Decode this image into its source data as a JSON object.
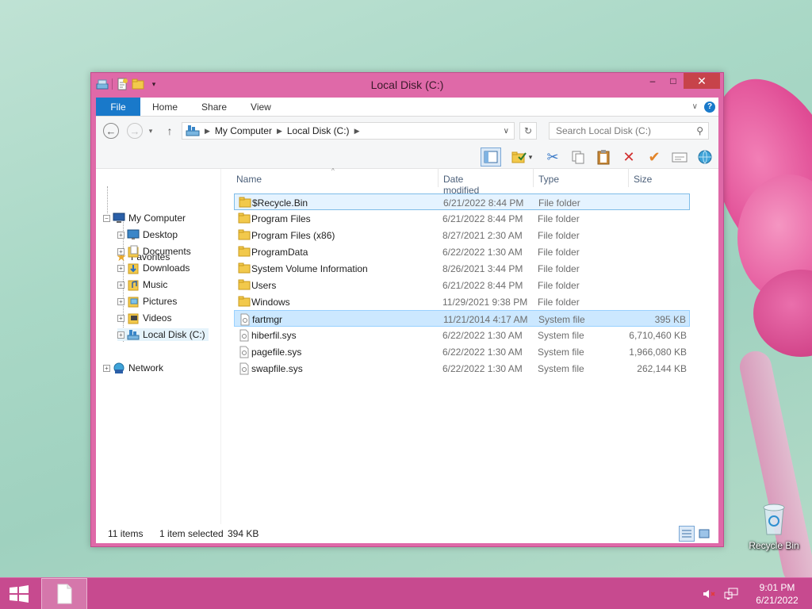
{
  "window": {
    "title": "Local Disk (C:)",
    "minimize_glyph": "–",
    "maximize_glyph": "□",
    "close_glyph": "✕"
  },
  "ribbon": {
    "tabs": [
      {
        "label": "File"
      },
      {
        "label": "Home"
      },
      {
        "label": "Share"
      },
      {
        "label": "View"
      }
    ],
    "help": "?"
  },
  "address": {
    "segments": [
      "My Computer",
      "Local Disk (C:)"
    ],
    "search_placeholder": "Search Local Disk (C:)"
  },
  "nav_pane": {
    "favorites": "Favorites",
    "my_computer": "My Computer",
    "children": [
      {
        "label": "Desktop",
        "icon": "desktop-icon"
      },
      {
        "label": "Documents",
        "icon": "documents-icon"
      },
      {
        "label": "Downloads",
        "icon": "downloads-icon"
      },
      {
        "label": "Music",
        "icon": "music-icon"
      },
      {
        "label": "Pictures",
        "icon": "pictures-icon"
      },
      {
        "label": "Videos",
        "icon": "videos-icon"
      },
      {
        "label": "Local Disk (C:)",
        "icon": "drive-icon"
      }
    ],
    "network": "Network"
  },
  "columns": {
    "name": "Name",
    "date": "Date modified",
    "type": "Type",
    "size": "Size"
  },
  "files": [
    {
      "name": "$Recycle.Bin",
      "date": "6/21/2022 8:44 PM",
      "type": "File folder",
      "size": "",
      "kind": "folder"
    },
    {
      "name": "Program Files",
      "date": "6/21/2022 8:44 PM",
      "type": "File folder",
      "size": "",
      "kind": "folder"
    },
    {
      "name": "Program Files (x86)",
      "date": "8/27/2021 2:30 AM",
      "type": "File folder",
      "size": "",
      "kind": "folder"
    },
    {
      "name": "ProgramData",
      "date": "6/22/2022 1:30 AM",
      "type": "File folder",
      "size": "",
      "kind": "folder"
    },
    {
      "name": "System Volume Information",
      "date": "8/26/2021 3:44 PM",
      "type": "File folder",
      "size": "",
      "kind": "folder"
    },
    {
      "name": "Users",
      "date": "6/21/2022 8:44 PM",
      "type": "File folder",
      "size": "",
      "kind": "folder"
    },
    {
      "name": "Windows",
      "date": "11/29/2021 9:38 PM",
      "type": "File folder",
      "size": "",
      "kind": "folder"
    },
    {
      "name": "fartmgr",
      "date": "11/21/2014 4:17 AM",
      "type": "System file",
      "size": "395 KB",
      "kind": "file"
    },
    {
      "name": "hiberfil.sys",
      "date": "6/22/2022 1:30 AM",
      "type": "System file",
      "size": "6,710,460 KB",
      "kind": "file"
    },
    {
      "name": "pagefile.sys",
      "date": "6/22/2022 1:30 AM",
      "type": "System file",
      "size": "1,966,080 KB",
      "kind": "file"
    },
    {
      "name": "swapfile.sys",
      "date": "6/22/2022 1:30 AM",
      "type": "System file",
      "size": "262,144 KB",
      "kind": "file"
    }
  ],
  "status": {
    "count": "11 items",
    "selected": "1 item selected",
    "size": "394 KB"
  },
  "desktop": {
    "recycle_bin_label": "Recycle Bin"
  },
  "taskbar": {
    "time": "9:01 PM",
    "date": "6/21/2022"
  },
  "colors": {
    "accent": "#df69a8",
    "file_tab": "#1979ca",
    "selection": "#cce8ff",
    "taskbar": "#c74a8f"
  }
}
